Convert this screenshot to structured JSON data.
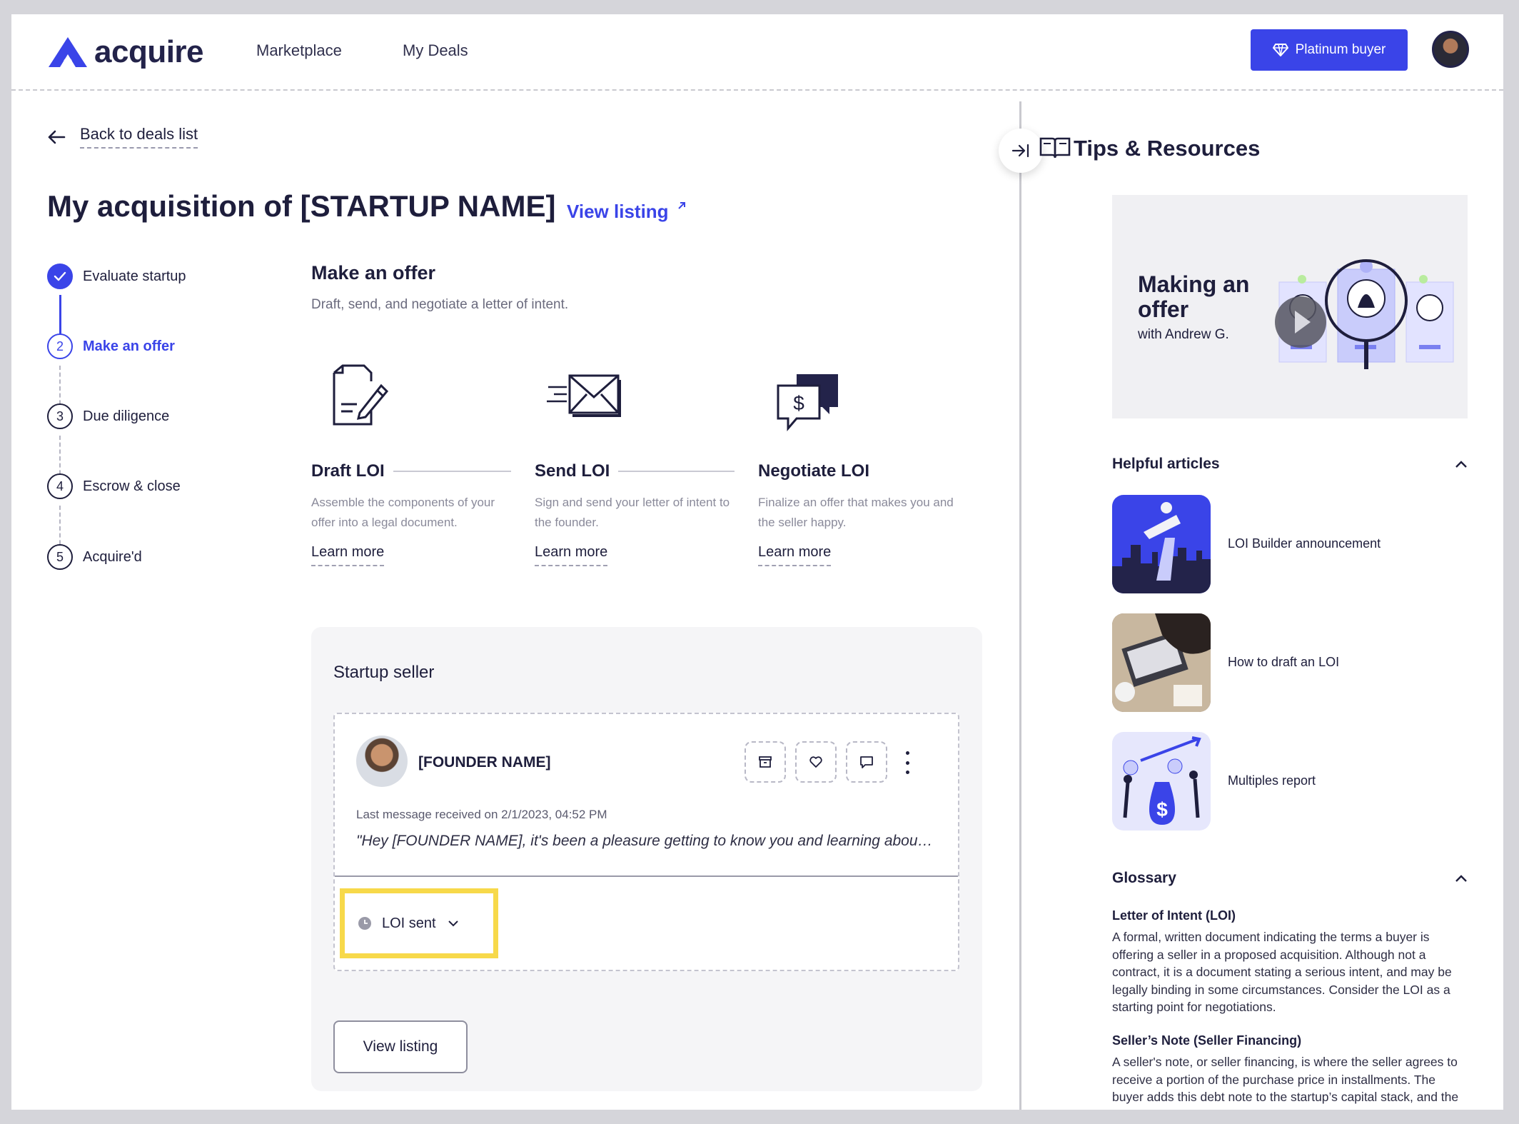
{
  "header": {
    "logo_text": "acquire",
    "nav": [
      "Marketplace",
      "My Deals"
    ],
    "platinum_label": "Platinum buyer"
  },
  "back_label": "Back to deals list",
  "page_title": "My acquisition of [STARTUP NAME]",
  "view_listing_link": "View listing",
  "steps": [
    {
      "number": "1",
      "label": "Evaluate startup",
      "state": "done"
    },
    {
      "number": "2",
      "label": "Make an offer",
      "state": "active"
    },
    {
      "number": "3",
      "label": "Due diligence",
      "state": "upcoming"
    },
    {
      "number": "4",
      "label": "Escrow & close",
      "state": "upcoming"
    },
    {
      "number": "5",
      "label": "Acquire'd",
      "state": "upcoming"
    }
  ],
  "offer": {
    "title": "Make an offer",
    "subtitle": "Draft, send, and negotiate a letter of intent.",
    "cards": [
      {
        "title": "Draft LOI",
        "desc": "Assemble the components of your offer into a legal document.",
        "link": "Learn more",
        "icon": "document-pen-icon"
      },
      {
        "title": "Send LOI",
        "desc": "Sign and send your letter of intent to the founder.",
        "link": "Learn more",
        "icon": "envelope-send-icon"
      },
      {
        "title": "Negotiate LOI",
        "desc": "Finalize an offer that makes you and the seller happy.",
        "link": "Learn more",
        "icon": "chat-dollar-icon"
      }
    ]
  },
  "seller": {
    "heading": "Startup seller",
    "founder_name": "[FOUNDER NAME]",
    "last_message_meta": "Last message received on 2/1/2023, 04:52 PM",
    "last_message": "\"Hey [FOUNDER NAME], it's been a pleasure getting to know you and learning about your startup. I'd like to move forward with an offer.\"",
    "status_label": "LOI sent",
    "view_listing_button": "View listing"
  },
  "tips": {
    "title": "Tips & Resources",
    "video_title": "Making an offer",
    "video_subtitle": "with Andrew G.",
    "articles_heading": "Helpful articles",
    "articles": [
      {
        "label": "LOI Builder announcement"
      },
      {
        "label": "How to draft an LOI"
      },
      {
        "label": "Multiples report"
      }
    ],
    "glossary_heading": "Glossary",
    "glossary": [
      {
        "term": "Letter of Intent (LOI)",
        "definition": "A formal, written document indicating the terms a buyer is offering a seller in a proposed acquisition. Although not a contract, it is a document stating a serious intent, and may be legally binding in some circumstances. Consider the LOI as a starting point for negotiations."
      },
      {
        "term": "Seller’s Note (Seller Financing)",
        "definition": "A seller's note, or seller financing, is where the seller agrees to receive a portion of the purchase price in installments. The buyer adds this debt note to the startup’s capital stack, and the seller becomes a creditor of the business."
      }
    ]
  },
  "colors": {
    "accent": "#3a44e8",
    "highlight": "#f7d94a",
    "text": "#1e1e3c"
  }
}
